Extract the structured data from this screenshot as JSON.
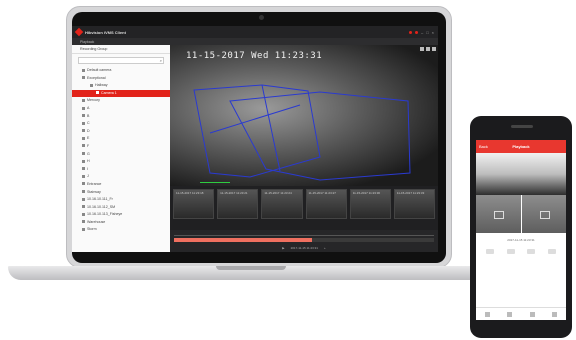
{
  "laptop": {
    "app_title": "Hikvision  iVMS Client",
    "tab_label": "Playback",
    "sidebar": {
      "header": "Recording Group",
      "search_placeholder": "",
      "items": [
        {
          "label": "Default camera",
          "level": 0
        },
        {
          "label": "Exceptional",
          "level": 0
        },
        {
          "label": "Hallway",
          "level": 1
        },
        {
          "label": "Camera 1",
          "level": 2,
          "selected": true
        },
        {
          "label": "Mercury",
          "level": 0
        },
        {
          "label": "A",
          "level": 0
        },
        {
          "label": "B",
          "level": 0
        },
        {
          "label": "C",
          "level": 0
        },
        {
          "label": "D",
          "level": 0
        },
        {
          "label": "E",
          "level": 0
        },
        {
          "label": "F",
          "level": 0
        },
        {
          "label": "G",
          "level": 0
        },
        {
          "label": "H",
          "level": 0
        },
        {
          "label": "I",
          "level": 0
        },
        {
          "label": "J",
          "level": 0
        },
        {
          "label": "Entrance",
          "level": 0
        },
        {
          "label": "Stairway",
          "level": 0
        },
        {
          "label": "10.16.10.111_Fr",
          "level": 0
        },
        {
          "label": "10.16.10.112_SM",
          "level": 0
        },
        {
          "label": "10.16.10.113_Fisheye",
          "level": 0
        },
        {
          "label": "Warehouse",
          "level": 0
        },
        {
          "label": "Storm",
          "level": 0
        }
      ]
    },
    "video": {
      "osd_timestamp": "11-15-2017 Wed 11:23:31"
    },
    "thumbnails": [
      {
        "caption": "11-15-2017 11:23:18"
      },
      {
        "caption": "11-15-2017 11:23:21"
      },
      {
        "caption": "11-15-2017 11:23:24"
      },
      {
        "caption": "11-15-2017 11:23:27"
      },
      {
        "caption": "11-15-2017 11:23:30"
      },
      {
        "caption": "11-15-2017 11:23:33"
      }
    ],
    "timeline": {
      "progress": 0.53,
      "center_label": "2017-11-15 11:23:31"
    }
  },
  "phone": {
    "title": "Playback",
    "back_label": "Back",
    "info_text": "2017-11-15 11:23:31",
    "accent": "#e8372f"
  },
  "colors": {
    "brand_red": "#e2231a",
    "timeline_fill": "#f07060",
    "roi_blue": "#2a3ad0"
  }
}
